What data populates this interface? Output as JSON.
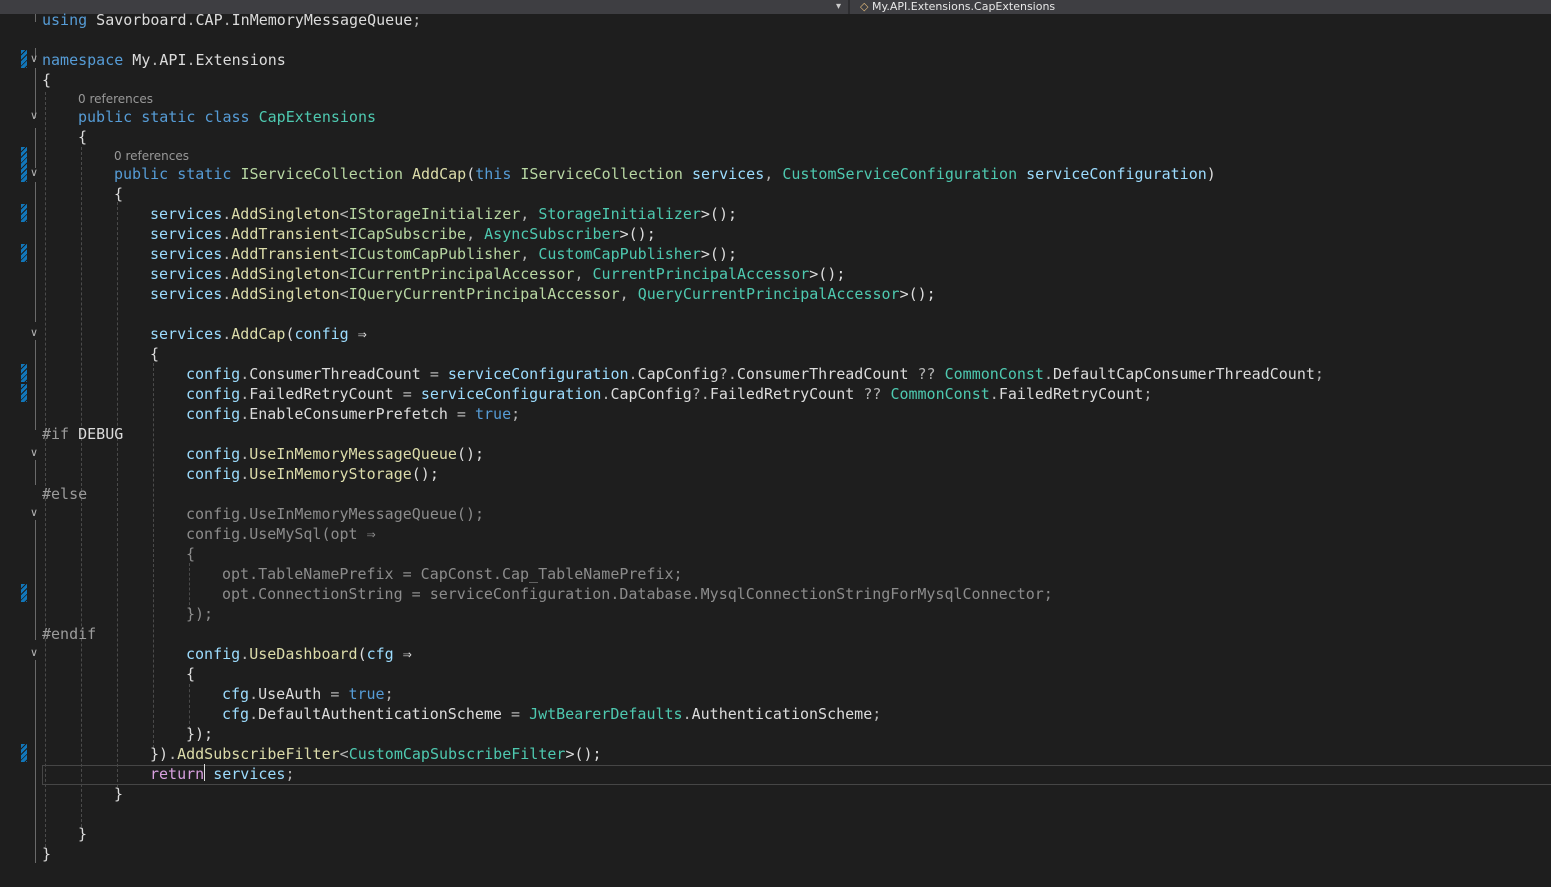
{
  "breadcrumb": {
    "icon": "class-icon",
    "label": "My.API.Extensions.CapExtensions"
  },
  "colors": {
    "keyword": "#569cd6",
    "type": "#4ec9b0",
    "interface": "#b8d7a3",
    "method": "#dcdcaa",
    "variable": "#9cdcfe",
    "control": "#d8a0df",
    "inactive": "#8c8c8c",
    "change_marker": "#1177bb"
  },
  "editor": {
    "current_line": 36,
    "lines": [
      {
        "indent": 0,
        "tokens": [
          [
            "using",
            "kw"
          ],
          [
            " Savorboard",
            "plain"
          ],
          [
            ".",
            "op"
          ],
          [
            "CAP",
            "plain"
          ],
          [
            ".",
            "op"
          ],
          [
            "InMemoryMessageQueue",
            "plain"
          ],
          [
            ";",
            "op"
          ]
        ]
      },
      {
        "indent": 0,
        "tokens": []
      },
      {
        "indent": 0,
        "changed": true,
        "fold": true,
        "tokens": [
          [
            "namespace",
            "kw"
          ],
          [
            " My",
            "plain"
          ],
          [
            ".",
            "op"
          ],
          [
            "API",
            "plain"
          ],
          [
            ".",
            "op"
          ],
          [
            "Extensions",
            "plain"
          ]
        ]
      },
      {
        "indent": 0,
        "tokens": [
          [
            "{",
            "plain"
          ]
        ]
      },
      {
        "indent": 4,
        "lens": "0 references",
        "fold": true,
        "tokens": [
          [
            "public",
            "kw"
          ],
          [
            " ",
            "plain"
          ],
          [
            "static",
            "kw"
          ],
          [
            " ",
            "plain"
          ],
          [
            "class",
            "kw"
          ],
          [
            " ",
            "plain"
          ],
          [
            "CapExtensions",
            "type"
          ]
        ]
      },
      {
        "indent": 4,
        "tokens": [
          [
            "{",
            "plain"
          ]
        ]
      },
      {
        "indent": 8,
        "lens": "0 references",
        "changed": true,
        "fold": true,
        "tokens": [
          [
            "public",
            "kw"
          ],
          [
            " ",
            "plain"
          ],
          [
            "static",
            "kw"
          ],
          [
            " ",
            "plain"
          ],
          [
            "IServiceCollection",
            "iface"
          ],
          [
            " ",
            "plain"
          ],
          [
            "AddCap",
            "method"
          ],
          [
            "(",
            "plain"
          ],
          [
            "this",
            "kw"
          ],
          [
            " ",
            "plain"
          ],
          [
            "IServiceCollection",
            "iface"
          ],
          [
            " ",
            "plain"
          ],
          [
            "services",
            "var"
          ],
          [
            ", ",
            "op"
          ],
          [
            "CustomServiceConfiguration",
            "type"
          ],
          [
            " ",
            "plain"
          ],
          [
            "serviceConfiguration",
            "var"
          ],
          [
            ")",
            "plain"
          ]
        ]
      },
      {
        "indent": 8,
        "tokens": [
          [
            "{",
            "plain"
          ]
        ]
      },
      {
        "indent": 12,
        "changed": true,
        "tokens": [
          [
            "services",
            "var"
          ],
          [
            ".",
            "op"
          ],
          [
            "AddSingleton",
            "method"
          ],
          [
            "<",
            "op"
          ],
          [
            "IStorageInitializer",
            "iface"
          ],
          [
            ", ",
            "op"
          ],
          [
            "StorageInitializer",
            "type"
          ],
          [
            ">();",
            "plain"
          ]
        ]
      },
      {
        "indent": 12,
        "tokens": [
          [
            "services",
            "var"
          ],
          [
            ".",
            "op"
          ],
          [
            "AddTransient",
            "method"
          ],
          [
            "<",
            "op"
          ],
          [
            "ICapSubscribe",
            "iface"
          ],
          [
            ", ",
            "op"
          ],
          [
            "AsyncSubscriber",
            "type"
          ],
          [
            ">();",
            "plain"
          ]
        ]
      },
      {
        "indent": 12,
        "changed": true,
        "tokens": [
          [
            "services",
            "var"
          ],
          [
            ".",
            "op"
          ],
          [
            "AddTransient",
            "method"
          ],
          [
            "<",
            "op"
          ],
          [
            "ICustomCapPublisher",
            "iface"
          ],
          [
            ", ",
            "op"
          ],
          [
            "CustomCapPublisher",
            "type"
          ],
          [
            ">();",
            "plain"
          ]
        ]
      },
      {
        "indent": 12,
        "tokens": [
          [
            "services",
            "var"
          ],
          [
            ".",
            "op"
          ],
          [
            "AddSingleton",
            "method"
          ],
          [
            "<",
            "op"
          ],
          [
            "ICurrentPrincipalAccessor",
            "iface"
          ],
          [
            ", ",
            "op"
          ],
          [
            "CurrentPrincipalAccessor",
            "type"
          ],
          [
            ">();",
            "plain"
          ]
        ]
      },
      {
        "indent": 12,
        "tokens": [
          [
            "services",
            "var"
          ],
          [
            ".",
            "op"
          ],
          [
            "AddSingleton",
            "method"
          ],
          [
            "<",
            "op"
          ],
          [
            "IQueryCurrentPrincipalAccessor",
            "iface"
          ],
          [
            ", ",
            "op"
          ],
          [
            "QueryCurrentPrincipalAccessor",
            "type"
          ],
          [
            ">();",
            "plain"
          ]
        ]
      },
      {
        "indent": 0,
        "tokens": []
      },
      {
        "indent": 12,
        "fold": true,
        "tokens": [
          [
            "services",
            "var"
          ],
          [
            ".",
            "op"
          ],
          [
            "AddCap",
            "method"
          ],
          [
            "(",
            "plain"
          ],
          [
            "config",
            "var"
          ],
          [
            " ⇒",
            "plain"
          ]
        ]
      },
      {
        "indent": 12,
        "tokens": [
          [
            "{",
            "plain"
          ]
        ]
      },
      {
        "indent": 16,
        "changed": true,
        "tokens": [
          [
            "config",
            "var"
          ],
          [
            ".",
            "op"
          ],
          [
            "ConsumerThreadCount",
            "plain"
          ],
          [
            " = ",
            "op"
          ],
          [
            "serviceConfiguration",
            "var"
          ],
          [
            ".",
            "op"
          ],
          [
            "CapConfig",
            "plain"
          ],
          [
            "?.",
            "op"
          ],
          [
            "ConsumerThreadCount",
            "plain"
          ],
          [
            " ?? ",
            "op"
          ],
          [
            "CommonConst",
            "type"
          ],
          [
            ".",
            "op"
          ],
          [
            "DefaultCapConsumerThreadCount",
            "plain"
          ],
          [
            ";",
            "op"
          ]
        ]
      },
      {
        "indent": 16,
        "changed": true,
        "tokens": [
          [
            "config",
            "var"
          ],
          [
            ".",
            "op"
          ],
          [
            "FailedRetryCount",
            "plain"
          ],
          [
            " = ",
            "op"
          ],
          [
            "serviceConfiguration",
            "var"
          ],
          [
            ".",
            "op"
          ],
          [
            "CapConfig",
            "plain"
          ],
          [
            "?.",
            "op"
          ],
          [
            "FailedRetryCount",
            "plain"
          ],
          [
            " ?? ",
            "op"
          ],
          [
            "CommonConst",
            "type"
          ],
          [
            ".",
            "op"
          ],
          [
            "FailedRetryCount",
            "plain"
          ],
          [
            ";",
            "op"
          ]
        ]
      },
      {
        "indent": 16,
        "tokens": [
          [
            "config",
            "var"
          ],
          [
            ".",
            "op"
          ],
          [
            "EnableConsumerPrefetch",
            "plain"
          ],
          [
            " = ",
            "op"
          ],
          [
            "true",
            "kw"
          ],
          [
            ";",
            "op"
          ]
        ]
      },
      {
        "indent": 0,
        "tokens": [
          [
            "#if",
            "pre"
          ],
          [
            " DEBUG",
            "plain"
          ]
        ]
      },
      {
        "indent": 16,
        "fold": true,
        "tokens": [
          [
            "config",
            "var"
          ],
          [
            ".",
            "op"
          ],
          [
            "UseInMemoryMessageQueue",
            "method"
          ],
          [
            "();",
            "plain"
          ]
        ]
      },
      {
        "indent": 16,
        "tokens": [
          [
            "config",
            "var"
          ],
          [
            ".",
            "op"
          ],
          [
            "UseInMemoryStorage",
            "method"
          ],
          [
            "();",
            "plain"
          ]
        ]
      },
      {
        "indent": 0,
        "tokens": [
          [
            "#else",
            "pre"
          ]
        ]
      },
      {
        "indent": 16,
        "fold": true,
        "tokens": [
          [
            "config.UseInMemoryMessageQueue();",
            "inactive"
          ]
        ]
      },
      {
        "indent": 16,
        "tokens": [
          [
            "config.UseMySql(opt ⇒",
            "inactive"
          ]
        ]
      },
      {
        "indent": 16,
        "tokens": [
          [
            "{",
            "inactive"
          ]
        ]
      },
      {
        "indent": 20,
        "tokens": [
          [
            "opt.TableNamePrefix = CapConst.Cap_TableNamePrefix;",
            "inactive"
          ]
        ]
      },
      {
        "indent": 20,
        "changed": true,
        "tokens": [
          [
            "opt.ConnectionString = serviceConfiguration",
            "inactive"
          ],
          [
            ".Database.MysqlConnectionStringForMysqlConnector;",
            "inactive"
          ]
        ]
      },
      {
        "indent": 16,
        "tokens": [
          [
            "});",
            "inactive"
          ]
        ]
      },
      {
        "indent": 0,
        "tokens": [
          [
            "#endif",
            "pre"
          ]
        ]
      },
      {
        "indent": 16,
        "fold": true,
        "tokens": [
          [
            "config",
            "var"
          ],
          [
            ".",
            "op"
          ],
          [
            "UseDashboard",
            "method"
          ],
          [
            "(",
            "plain"
          ],
          [
            "cfg",
            "var"
          ],
          [
            " ⇒",
            "plain"
          ]
        ]
      },
      {
        "indent": 16,
        "tokens": [
          [
            "{",
            "plain"
          ]
        ]
      },
      {
        "indent": 20,
        "tokens": [
          [
            "cfg",
            "var"
          ],
          [
            ".",
            "op"
          ],
          [
            "UseAuth",
            "plain"
          ],
          [
            " = ",
            "op"
          ],
          [
            "true",
            "kw"
          ],
          [
            ";",
            "op"
          ]
        ]
      },
      {
        "indent": 20,
        "tokens": [
          [
            "cfg",
            "var"
          ],
          [
            ".",
            "op"
          ],
          [
            "DefaultAuthenticationScheme",
            "plain"
          ],
          [
            " = ",
            "op"
          ],
          [
            "JwtBearerDefaults",
            "type"
          ],
          [
            ".",
            "op"
          ],
          [
            "AuthenticationScheme",
            "plain"
          ],
          [
            ";",
            "op"
          ]
        ]
      },
      {
        "indent": 16,
        "tokens": [
          [
            "});",
            "plain"
          ]
        ]
      },
      {
        "indent": 12,
        "changed": true,
        "tokens": [
          [
            "})",
            "plain"
          ],
          [
            ".",
            "op"
          ],
          [
            "AddSubscribeFilter",
            "method"
          ],
          [
            "<",
            "op"
          ],
          [
            "CustomCapSubscribeFilter",
            "type"
          ],
          [
            ">();",
            "plain"
          ]
        ]
      },
      {
        "indent": 12,
        "tokens": [
          [
            "return",
            "ctl"
          ],
          [
            " ",
            "plain"
          ],
          [
            "services",
            "var"
          ],
          [
            ";",
            "op"
          ]
        ]
      },
      {
        "indent": 8,
        "tokens": [
          [
            "}",
            "plain"
          ]
        ]
      },
      {
        "indent": 0,
        "tokens": []
      },
      {
        "indent": 4,
        "tokens": [
          [
            "}",
            "plain"
          ]
        ]
      },
      {
        "indent": 0,
        "tokens": [
          [
            "}",
            "plain"
          ]
        ]
      }
    ]
  }
}
